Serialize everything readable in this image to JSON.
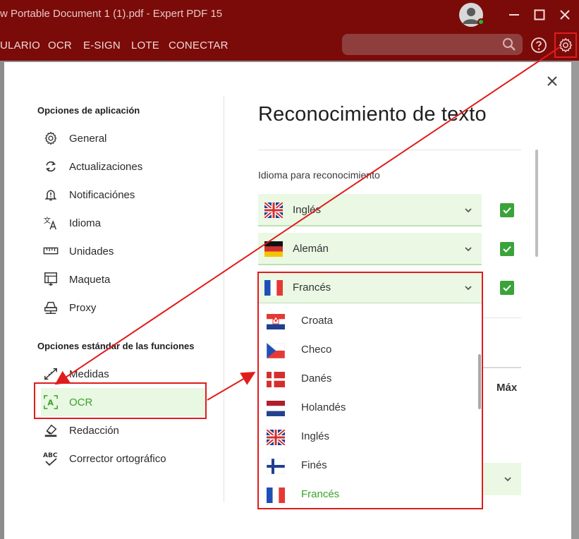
{
  "window": {
    "title": "w Portable Document 1 (1).pdf   -   Expert PDF 15"
  },
  "ribbon": {
    "menu": [
      "ULARIO",
      "OCR",
      "E-SIGN",
      "LOTE",
      "CONECTAR"
    ]
  },
  "sidebar": {
    "app_section_title": "Opciones de aplicación",
    "app_items": [
      {
        "label": "General",
        "icon": "gear-icon"
      },
      {
        "label": "Actualizaciones",
        "icon": "refresh-icon"
      },
      {
        "label": "Notificaciónes",
        "icon": "bell-icon"
      },
      {
        "label": "Idioma",
        "icon": "translate-icon"
      },
      {
        "label": "Unidades",
        "icon": "ruler-icon"
      },
      {
        "label": "Maqueta",
        "icon": "layout-icon"
      },
      {
        "label": "Proxy",
        "icon": "proxy-icon"
      }
    ],
    "func_section_title": "Opciones estándar de las funciones",
    "func_items": [
      {
        "label": "Medidas",
        "icon": "measure-icon"
      },
      {
        "label": "OCR",
        "icon": "ocr-icon",
        "active": true
      },
      {
        "label": "Redacción",
        "icon": "eraser-icon"
      },
      {
        "label": "Corrector ortográfico",
        "icon": "spellcheck-icon"
      }
    ]
  },
  "main": {
    "title": "Reconocimiento de texto",
    "language_label": "Idioma para reconocimiento",
    "languages": [
      {
        "label": "Inglés",
        "flag": "uk-flag",
        "checked": true
      },
      {
        "label": "Alemán",
        "flag": "germany-flag",
        "checked": true
      },
      {
        "label": "Francés",
        "flag": "france-flag",
        "checked": true
      }
    ],
    "max_label": "Máx"
  },
  "dropdown": {
    "options": [
      {
        "label": "Croata",
        "flag": "croatia-flag"
      },
      {
        "label": "Checo",
        "flag": "czech-flag"
      },
      {
        "label": "Danés",
        "flag": "denmark-flag"
      },
      {
        "label": "Holandés",
        "flag": "netherlands-flag"
      },
      {
        "label": "Inglés",
        "flag": "uk-flag"
      },
      {
        "label": "Finés",
        "flag": "finland-flag"
      },
      {
        "label": "Francés",
        "flag": "france-flag",
        "selected": true
      }
    ]
  },
  "colors": {
    "titlebar": "#7a0b09",
    "accent_green": "#3aa229",
    "active_bg": "#e8f8e2",
    "annotation_red": "#e01c1c"
  }
}
